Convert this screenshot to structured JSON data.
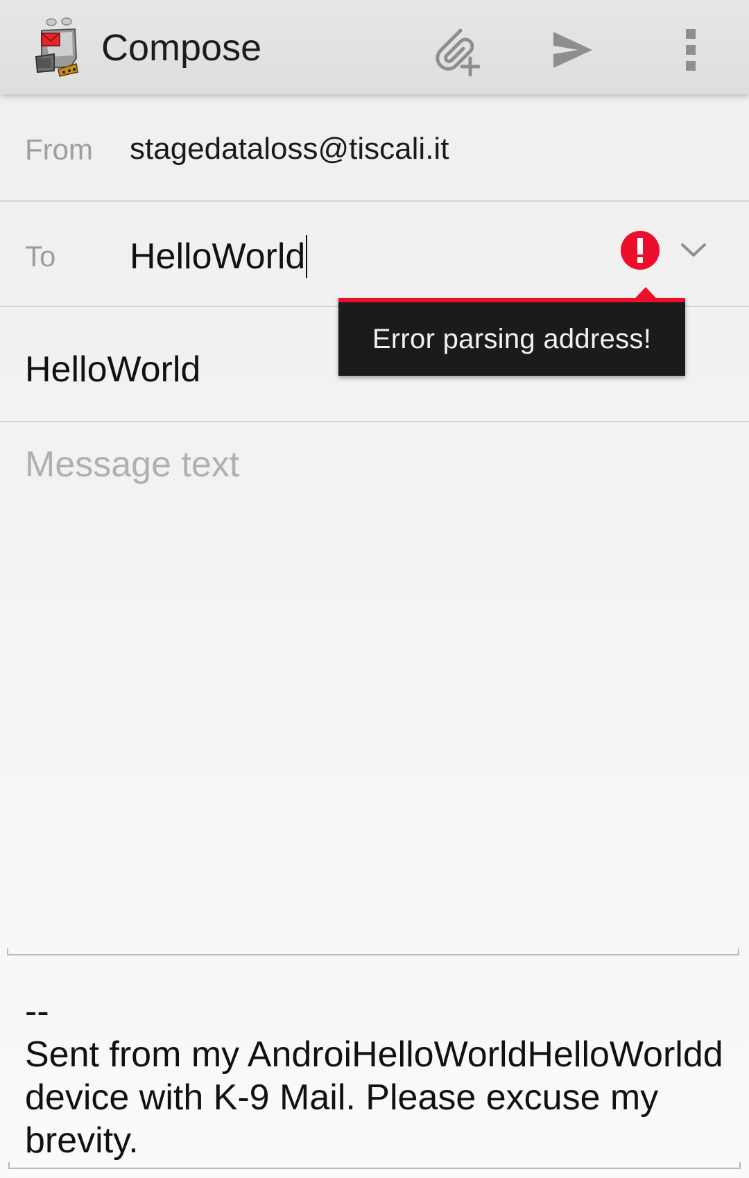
{
  "action_bar": {
    "title": "Compose",
    "icons": {
      "logo": "k9-mail-logo",
      "attach": "attach-file-icon",
      "send": "send-icon",
      "more": "more-vert-icon"
    }
  },
  "from": {
    "label": "From",
    "value": "stagedataloss@tiscali.it"
  },
  "to": {
    "label": "To",
    "value": "HelloWorld",
    "error_icon": "error-icon",
    "expand_icon": "chevron-down-icon"
  },
  "tooltip": {
    "text": "Error parsing address!"
  },
  "subject": {
    "value": "HelloWorld"
  },
  "message": {
    "placeholder": "Message text",
    "value": ""
  },
  "signature": {
    "text": "--\nSent from my AndroiHelloWorldHelloWorldd device with K-9 Mail. Please excuse my brevity."
  },
  "colors": {
    "error": "#ed0e2c",
    "tooltip_bg": "#1b1b1b",
    "label": "#9e9e9e",
    "text": "#111111"
  }
}
